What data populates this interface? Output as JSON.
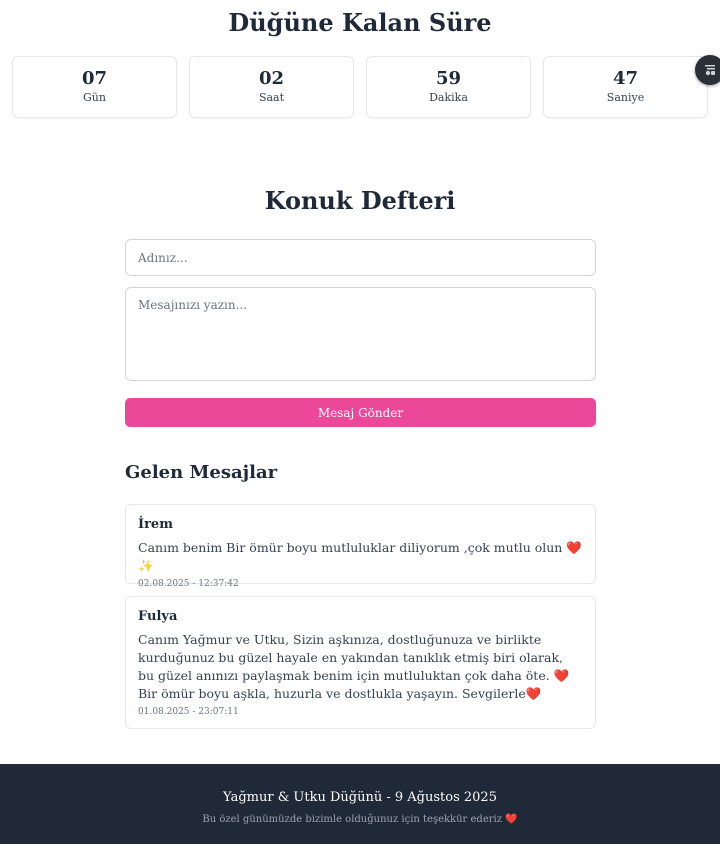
{
  "countdown": {
    "title": "Düğüne Kalan Süre",
    "units": [
      {
        "value": "07",
        "label": "Gün"
      },
      {
        "value": "02",
        "label": "Saat"
      },
      {
        "value": "59",
        "label": "Dakika"
      },
      {
        "value": "47",
        "label": "Saniye"
      }
    ]
  },
  "music_button": {
    "icon": "music-toggle-icon"
  },
  "guestbook": {
    "title": "Konuk Defteri",
    "name_placeholder": "Adınız...",
    "message_placeholder": "Mesajınızı yazın...",
    "submit_label": "Mesaj Gönder",
    "submit_color": "#ec4899"
  },
  "messages": {
    "title": "Gelen Mesajlar",
    "items": [
      {
        "name": "İrem",
        "text": "Canım benim Bir ömür boyu mutluluklar diliyorum ,çok mutlu olun ❤️✨",
        "date": "02.08.2025 - 12:37:42"
      },
      {
        "name": "Fulya",
        "text": "Canım Yağmur ve Utku, Sizin aşkınıza, dostluğunuza ve birlikte kurduğunuz bu güzel hayale en yakından tanıklık etmiş biri olarak, bu güzel anınızı paylaşmak benim için mutluluktan çok daha öte. ❤️ Bir ömür boyu aşkla, huzurla ve dostlukla yaşayın. Sevgilerle❤️",
        "date": "01.08.2025 - 23:07:11"
      }
    ]
  },
  "footer": {
    "title": "Yağmur & Utku Düğünü - 9 Ağustos 2025",
    "subtitle": "Bu özel günümüzde bizimle olduğunuz için teşekkür ederiz ❤️",
    "background": "#1f2937"
  }
}
